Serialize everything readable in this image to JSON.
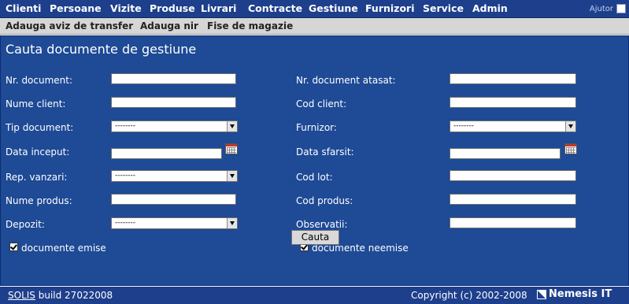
{
  "topnav": {
    "items": [
      "Clienti",
      "Persoane",
      "Vizite",
      "Produse",
      "Livrari",
      "Contracte",
      "Gestiune",
      "Furnizori",
      "Service",
      "Admin"
    ],
    "help_label": "Ajutor"
  },
  "subnav": {
    "items": [
      "Adauga aviz de transfer",
      "Adauga nir",
      "Fise de magazie"
    ]
  },
  "form": {
    "title": "Cauta documente de gestiune",
    "left": {
      "nr_document": "Nr. document:",
      "nume_client": "Nume client:",
      "tip_document": "Tip document:",
      "tip_document_value": "--------",
      "data_inceput": "Data inceput:",
      "rep_vanzari": "Rep. vanzari:",
      "rep_vanzari_value": "--------",
      "nume_produs": "Nume produs:",
      "depozit": "Depozit:",
      "depozit_value": "--------",
      "documente_emise": "documente emise"
    },
    "right": {
      "nr_document_atasat": "Nr. document atasat:",
      "cod_client": "Cod client:",
      "furnizor": "Furnizor:",
      "furnizor_value": "--------",
      "data_sfarsit": "Data sfarsit:",
      "cod_lot": "Cod lot:",
      "cod_produs": "Cod produs:",
      "observatii": "Observatii:",
      "documente_neemise": "documente neemise"
    },
    "search_button": "Cauta"
  },
  "footer": {
    "brand": "SOLIS",
    "build": " build 27022008",
    "copyright": "Copyright (c) 2002-2008",
    "company": "Nemesis IT"
  },
  "colors": {
    "nav_bg": "#1d3f8c",
    "panel_bg": "#1e4a96",
    "subnav_bg": "#d6d6d6"
  }
}
